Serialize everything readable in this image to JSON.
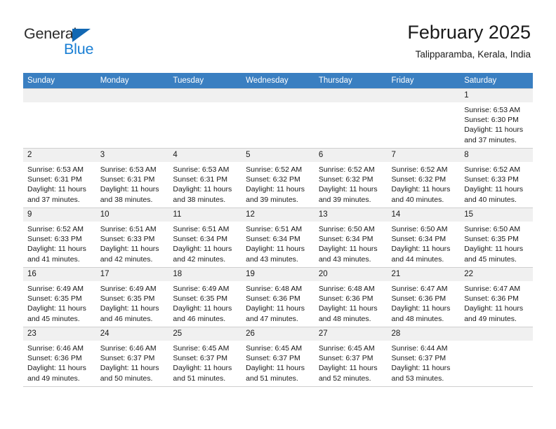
{
  "logo": {
    "word_one": "General",
    "word_two": "Blue",
    "triangle_color": "#1268b3",
    "blue_color": "#1a7fd4"
  },
  "header": {
    "title": "February 2025",
    "subtitle": "Talipparamba, Kerala, India",
    "header_bg": "#3a7fc1"
  },
  "weekday_headers": [
    "Sunday",
    "Monday",
    "Tuesday",
    "Wednesday",
    "Thursday",
    "Friday",
    "Saturday"
  ],
  "labels": {
    "sunrise": "Sunrise:",
    "sunset": "Sunset:",
    "daylight": "Daylight:"
  },
  "weeks": [
    [
      {
        "day": "",
        "empty": true
      },
      {
        "day": "",
        "empty": true
      },
      {
        "day": "",
        "empty": true
      },
      {
        "day": "",
        "empty": true
      },
      {
        "day": "",
        "empty": true
      },
      {
        "day": "",
        "empty": true
      },
      {
        "day": "1",
        "sunrise": "Sunrise: 6:53 AM",
        "sunset": "Sunset: 6:30 PM",
        "daylight": "Daylight: 11 hours and 37 minutes."
      }
    ],
    [
      {
        "day": "2",
        "sunrise": "Sunrise: 6:53 AM",
        "sunset": "Sunset: 6:31 PM",
        "daylight": "Daylight: 11 hours and 37 minutes."
      },
      {
        "day": "3",
        "sunrise": "Sunrise: 6:53 AM",
        "sunset": "Sunset: 6:31 PM",
        "daylight": "Daylight: 11 hours and 38 minutes."
      },
      {
        "day": "4",
        "sunrise": "Sunrise: 6:53 AM",
        "sunset": "Sunset: 6:31 PM",
        "daylight": "Daylight: 11 hours and 38 minutes."
      },
      {
        "day": "5",
        "sunrise": "Sunrise: 6:52 AM",
        "sunset": "Sunset: 6:32 PM",
        "daylight": "Daylight: 11 hours and 39 minutes."
      },
      {
        "day": "6",
        "sunrise": "Sunrise: 6:52 AM",
        "sunset": "Sunset: 6:32 PM",
        "daylight": "Daylight: 11 hours and 39 minutes."
      },
      {
        "day": "7",
        "sunrise": "Sunrise: 6:52 AM",
        "sunset": "Sunset: 6:32 PM",
        "daylight": "Daylight: 11 hours and 40 minutes."
      },
      {
        "day": "8",
        "sunrise": "Sunrise: 6:52 AM",
        "sunset": "Sunset: 6:33 PM",
        "daylight": "Daylight: 11 hours and 40 minutes."
      }
    ],
    [
      {
        "day": "9",
        "sunrise": "Sunrise: 6:52 AM",
        "sunset": "Sunset: 6:33 PM",
        "daylight": "Daylight: 11 hours and 41 minutes."
      },
      {
        "day": "10",
        "sunrise": "Sunrise: 6:51 AM",
        "sunset": "Sunset: 6:33 PM",
        "daylight": "Daylight: 11 hours and 42 minutes."
      },
      {
        "day": "11",
        "sunrise": "Sunrise: 6:51 AM",
        "sunset": "Sunset: 6:34 PM",
        "daylight": "Daylight: 11 hours and 42 minutes."
      },
      {
        "day": "12",
        "sunrise": "Sunrise: 6:51 AM",
        "sunset": "Sunset: 6:34 PM",
        "daylight": "Daylight: 11 hours and 43 minutes."
      },
      {
        "day": "13",
        "sunrise": "Sunrise: 6:50 AM",
        "sunset": "Sunset: 6:34 PM",
        "daylight": "Daylight: 11 hours and 43 minutes."
      },
      {
        "day": "14",
        "sunrise": "Sunrise: 6:50 AM",
        "sunset": "Sunset: 6:34 PM",
        "daylight": "Daylight: 11 hours and 44 minutes."
      },
      {
        "day": "15",
        "sunrise": "Sunrise: 6:50 AM",
        "sunset": "Sunset: 6:35 PM",
        "daylight": "Daylight: 11 hours and 45 minutes."
      }
    ],
    [
      {
        "day": "16",
        "sunrise": "Sunrise: 6:49 AM",
        "sunset": "Sunset: 6:35 PM",
        "daylight": "Daylight: 11 hours and 45 minutes."
      },
      {
        "day": "17",
        "sunrise": "Sunrise: 6:49 AM",
        "sunset": "Sunset: 6:35 PM",
        "daylight": "Daylight: 11 hours and 46 minutes."
      },
      {
        "day": "18",
        "sunrise": "Sunrise: 6:49 AM",
        "sunset": "Sunset: 6:35 PM",
        "daylight": "Daylight: 11 hours and 46 minutes."
      },
      {
        "day": "19",
        "sunrise": "Sunrise: 6:48 AM",
        "sunset": "Sunset: 6:36 PM",
        "daylight": "Daylight: 11 hours and 47 minutes."
      },
      {
        "day": "20",
        "sunrise": "Sunrise: 6:48 AM",
        "sunset": "Sunset: 6:36 PM",
        "daylight": "Daylight: 11 hours and 48 minutes."
      },
      {
        "day": "21",
        "sunrise": "Sunrise: 6:47 AM",
        "sunset": "Sunset: 6:36 PM",
        "daylight": "Daylight: 11 hours and 48 minutes."
      },
      {
        "day": "22",
        "sunrise": "Sunrise: 6:47 AM",
        "sunset": "Sunset: 6:36 PM",
        "daylight": "Daylight: 11 hours and 49 minutes."
      }
    ],
    [
      {
        "day": "23",
        "sunrise": "Sunrise: 6:46 AM",
        "sunset": "Sunset: 6:36 PM",
        "daylight": "Daylight: 11 hours and 49 minutes."
      },
      {
        "day": "24",
        "sunrise": "Sunrise: 6:46 AM",
        "sunset": "Sunset: 6:37 PM",
        "daylight": "Daylight: 11 hours and 50 minutes."
      },
      {
        "day": "25",
        "sunrise": "Sunrise: 6:45 AM",
        "sunset": "Sunset: 6:37 PM",
        "daylight": "Daylight: 11 hours and 51 minutes."
      },
      {
        "day": "26",
        "sunrise": "Sunrise: 6:45 AM",
        "sunset": "Sunset: 6:37 PM",
        "daylight": "Daylight: 11 hours and 51 minutes."
      },
      {
        "day": "27",
        "sunrise": "Sunrise: 6:45 AM",
        "sunset": "Sunset: 6:37 PM",
        "daylight": "Daylight: 11 hours and 52 minutes."
      },
      {
        "day": "28",
        "sunrise": "Sunrise: 6:44 AM",
        "sunset": "Sunset: 6:37 PM",
        "daylight": "Daylight: 11 hours and 53 minutes."
      },
      {
        "day": "",
        "empty": true
      }
    ]
  ]
}
